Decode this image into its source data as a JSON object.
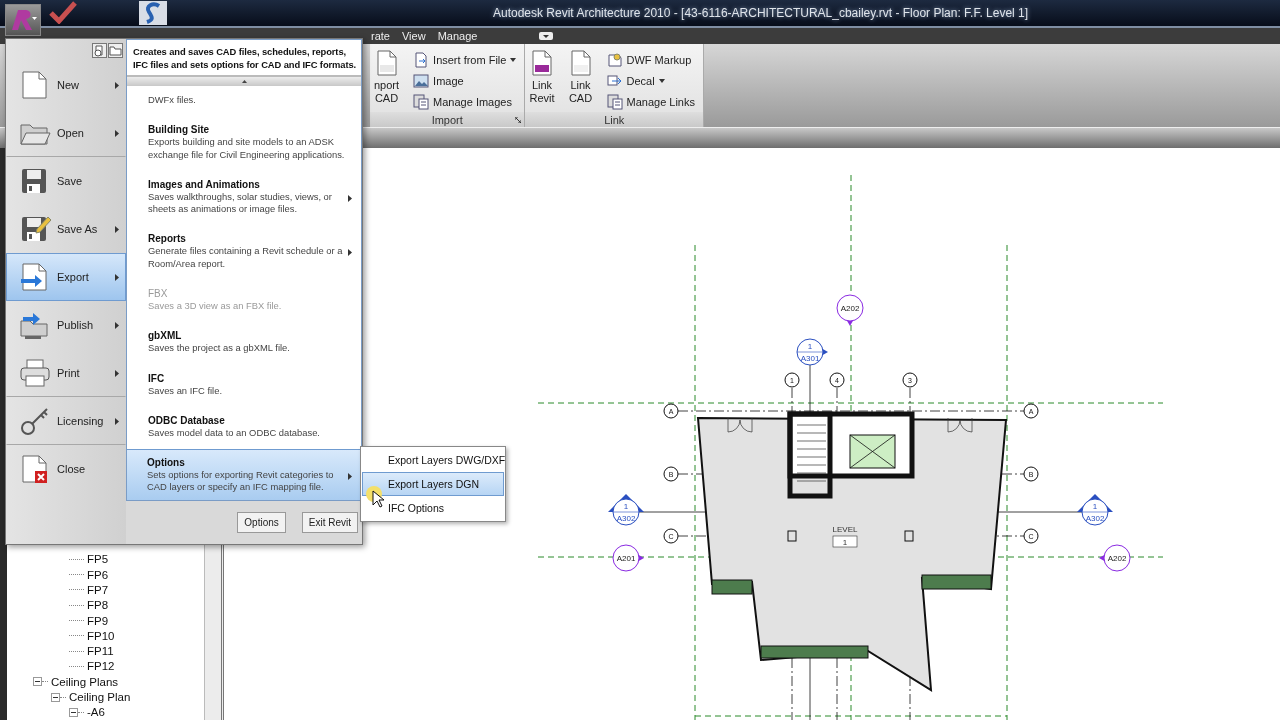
{
  "title_bar": {
    "title": "Autodesk Revit Architecture 2010 - [43-6116-ARCHITECTURAL_cbailey.rvt - Floor Plan: F.F. Level 1]"
  },
  "ribbon": {
    "tabs": [
      {
        "label": "rate"
      },
      {
        "label": "View"
      },
      {
        "label": "Manage"
      }
    ],
    "panels": [
      {
        "title": "Import",
        "launcher": true,
        "items": [
          {
            "kind": "large",
            "lines": [
              "nport",
              "CAD"
            ]
          },
          {
            "kind": "small",
            "label": "Insert from File",
            "dropdown": true
          },
          {
            "kind": "small",
            "label": "Image",
            "dropdown": false
          },
          {
            "kind": "small",
            "label": "Manage Images",
            "dropdown": false
          }
        ]
      },
      {
        "title": "Link",
        "launcher": false,
        "items": [
          {
            "kind": "large",
            "lines": [
              "Link",
              "Revit"
            ]
          },
          {
            "kind": "large",
            "lines": [
              "Link",
              "CAD"
            ]
          },
          {
            "kind": "small",
            "label": "DWF Markup",
            "dropdown": false
          },
          {
            "kind": "small",
            "label": "Decal",
            "dropdown": true
          },
          {
            "kind": "small",
            "label": "Manage Links",
            "dropdown": false
          }
        ]
      }
    ]
  },
  "app_menu": {
    "header": "Creates and saves CAD files, schedules, reports,\nIFC files and sets options for CAD and IFC formats.",
    "commands": [
      {
        "kind": "new",
        "label": "New",
        "submenu": true,
        "selected": false,
        "divider_after": false
      },
      {
        "kind": "open",
        "label": "Open",
        "submenu": true,
        "selected": false,
        "divider_after": true
      },
      {
        "kind": "save",
        "label": "Save",
        "submenu": false,
        "selected": false,
        "divider_after": false
      },
      {
        "kind": "save_as",
        "label": "Save As",
        "submenu": true,
        "selected": false,
        "divider_after": false
      },
      {
        "kind": "export",
        "label": "Export",
        "submenu": true,
        "selected": true,
        "divider_after": false
      },
      {
        "kind": "publish",
        "label": "Publish",
        "submenu": true,
        "selected": false,
        "divider_after": false
      },
      {
        "kind": "print",
        "label": "Print",
        "submenu": true,
        "selected": false,
        "divider_after": true
      },
      {
        "kind": "licensing",
        "label": "Licensing",
        "submenu": true,
        "selected": false,
        "divider_after": true
      },
      {
        "kind": "close",
        "label": "Close",
        "submenu": false,
        "selected": false,
        "divider_after": false
      }
    ],
    "entries": [
      {
        "description": "DWFx files.",
        "submenu": false,
        "selected": false,
        "disabled": false
      },
      {
        "title": "Building Site",
        "description": "Exports building and site models to an ADSK exchange file for Civil Engineering applications.",
        "submenu": false,
        "selected": false,
        "disabled": false
      },
      {
        "title": "Images and Animations",
        "description": "Saves walkthroughs, solar studies, views, or sheets as animations or image files.",
        "submenu": true,
        "selected": false,
        "disabled": false
      },
      {
        "title": "Reports",
        "description": "Generate files containing a Revit schedule or a Room/Area report.",
        "submenu": true,
        "selected": false,
        "disabled": false
      },
      {
        "title": "FBX",
        "description": "Saves a 3D view as an FBX file.",
        "submenu": false,
        "selected": false,
        "disabled": true
      },
      {
        "title": "gbXML",
        "description": "Saves the project as a gbXML file.",
        "submenu": false,
        "selected": false,
        "disabled": false
      },
      {
        "title": "IFC",
        "description": "Saves an IFC file.",
        "submenu": false,
        "selected": false,
        "disabled": false
      },
      {
        "title": "ODBC Database",
        "description": "Saves model data to an ODBC database.",
        "submenu": false,
        "selected": false,
        "disabled": false
      },
      {
        "title": "Options",
        "description": "Sets options for exporting Revit categories to CAD layers or specify an IFC mapping file.",
        "submenu": true,
        "selected": true,
        "disabled": false
      }
    ],
    "buttons": [
      "Options",
      "Exit Revit"
    ]
  },
  "submenu": {
    "items": [
      {
        "label": "Export Layers DWG/DXF",
        "selected": false
      },
      {
        "label": "Export Layers DGN",
        "selected": true
      },
      {
        "label": "IFC Options",
        "selected": false
      }
    ]
  },
  "browser": {
    "tree": [
      {
        "children": [
          {
            "children": [
              {
                "label": "FP5"
              },
              {
                "label": "FP6"
              },
              {
                "label": "FP7"
              },
              {
                "label": "FP8"
              },
              {
                "label": "FP9"
              },
              {
                "label": "FP10"
              },
              {
                "label": "FP11"
              },
              {
                "label": "FP12"
              }
            ]
          }
        ]
      },
      {
        "label": "Ceiling Plans",
        "expanded": true,
        "children": [
          {
            "label": "Ceiling Plan",
            "expanded": true,
            "children": [
              {
                "label": "-A6",
                "expanded": true
              }
            ]
          }
        ]
      }
    ]
  },
  "plan": {
    "grid_columns": [
      {
        "label": "1"
      },
      {
        "label": "4"
      },
      {
        "label": "3"
      }
    ],
    "grid_rows": [
      {
        "left": "A",
        "right": "A"
      },
      {
        "left": "B",
        "right": "B"
      },
      {
        "left": "C",
        "right": "C"
      }
    ],
    "marks": [
      {
        "kind": "elevation",
        "sheet": "A202"
      },
      {
        "kind": "section",
        "number": "1",
        "sheet": "A301"
      },
      {
        "kind": "section",
        "number": "1",
        "sheet": "A302"
      },
      {
        "kind": "section",
        "number": "1",
        "sheet": "A302"
      },
      {
        "kind": "elevation",
        "sheet": "A201"
      },
      {
        "kind": "elevation",
        "sheet": "A202"
      }
    ],
    "level_tag": {
      "label": "LEVEL",
      "value": "1"
    }
  }
}
